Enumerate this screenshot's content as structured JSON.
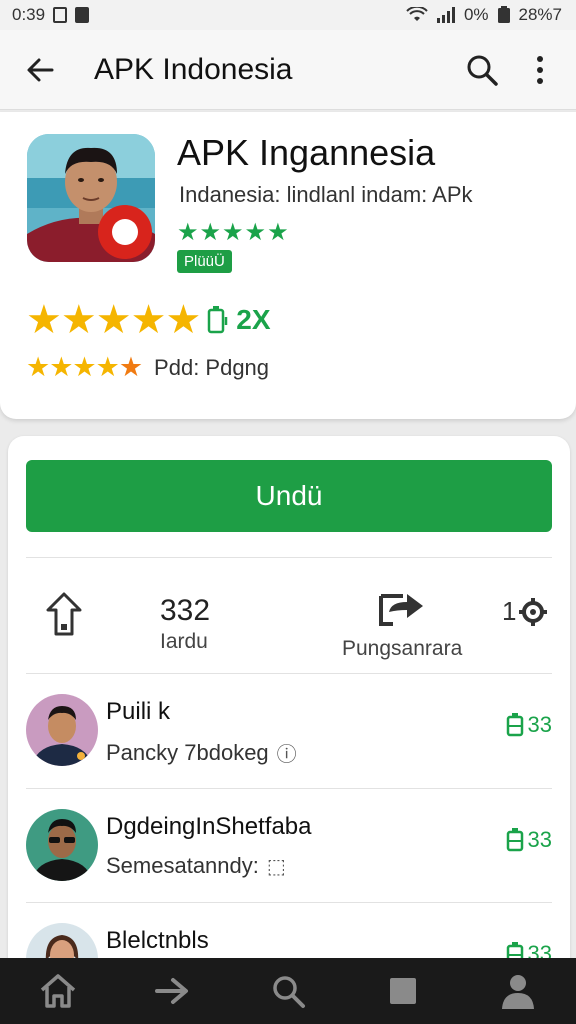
{
  "status_bar": {
    "time": "0:39",
    "battery_percent": "0%",
    "right_text": "28%7"
  },
  "app_bar": {
    "title": "APK Indonesia"
  },
  "app": {
    "name": "APK Ingannesia",
    "subtitle": "Indanesia: lindlanl indam: APk",
    "green_stars": "★★★★★",
    "tag": "PlüüÜ",
    "rating_large_stars": "★★★★★",
    "rating_count": "2X",
    "rating_small_stars": "★★★★",
    "rating_small_last_star": "★",
    "rating_small_label": "Pdd: Pdgng"
  },
  "actions": {
    "download_label": "Undü"
  },
  "stats": {
    "count_value": "332",
    "count_label": "Iardu",
    "permissions_label": "Pungsanrara",
    "settings_value": "1"
  },
  "list": [
    {
      "name": "Puili k",
      "sub": "Pancky 7bdokeg",
      "sub_icon": "ⓘ",
      "score": "33"
    },
    {
      "name": "DgdeingInShetfaba",
      "sub": "Semesatanndy:",
      "sub_icon": "⬚",
      "score": "33"
    },
    {
      "name": "Blelctnbls",
      "sub": "",
      "sub_icon": "",
      "score": "33"
    }
  ],
  "colors": {
    "accent_green": "#1e9e45",
    "star_yellow": "#f5b500",
    "star_orange": "#f07b12",
    "nav_background": "#1a1a1a"
  }
}
